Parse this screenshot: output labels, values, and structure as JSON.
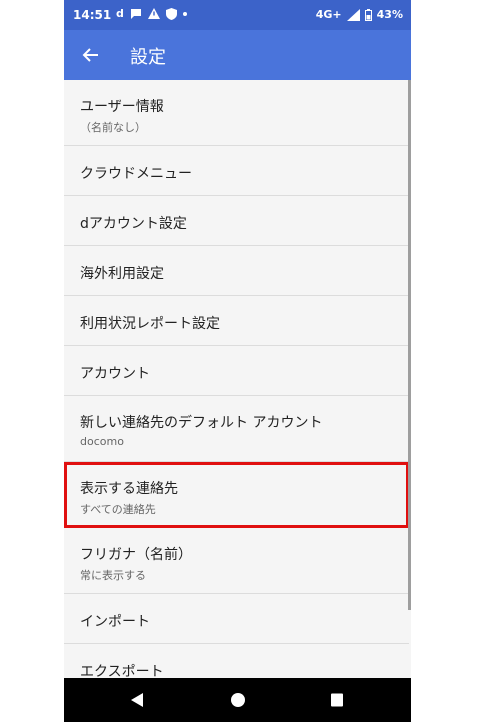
{
  "status": {
    "time": "14:51",
    "notif_d": "d",
    "signal": "4G+",
    "battery": "43%"
  },
  "header": {
    "title": "設定"
  },
  "items": [
    {
      "label": "ユーザー情報",
      "sub": "（名前なし）"
    },
    {
      "label": "クラウドメニュー"
    },
    {
      "label": "dアカウント設定"
    },
    {
      "label": "海外利用設定"
    },
    {
      "label": "利用状況レポート設定"
    },
    {
      "label": "アカウント"
    },
    {
      "label": "新しい連絡先のデフォルト アカウント",
      "sub": "docomo"
    },
    {
      "label": "表示する連絡先",
      "sub": "すべての連絡先"
    },
    {
      "label": "フリガナ（名前）",
      "sub": "常に表示する"
    },
    {
      "label": "インポート"
    },
    {
      "label": "エクスポート"
    }
  ],
  "colors": {
    "status_bar": "#3c63c9",
    "app_bar": "#4a74db",
    "highlight": "#e01010"
  }
}
